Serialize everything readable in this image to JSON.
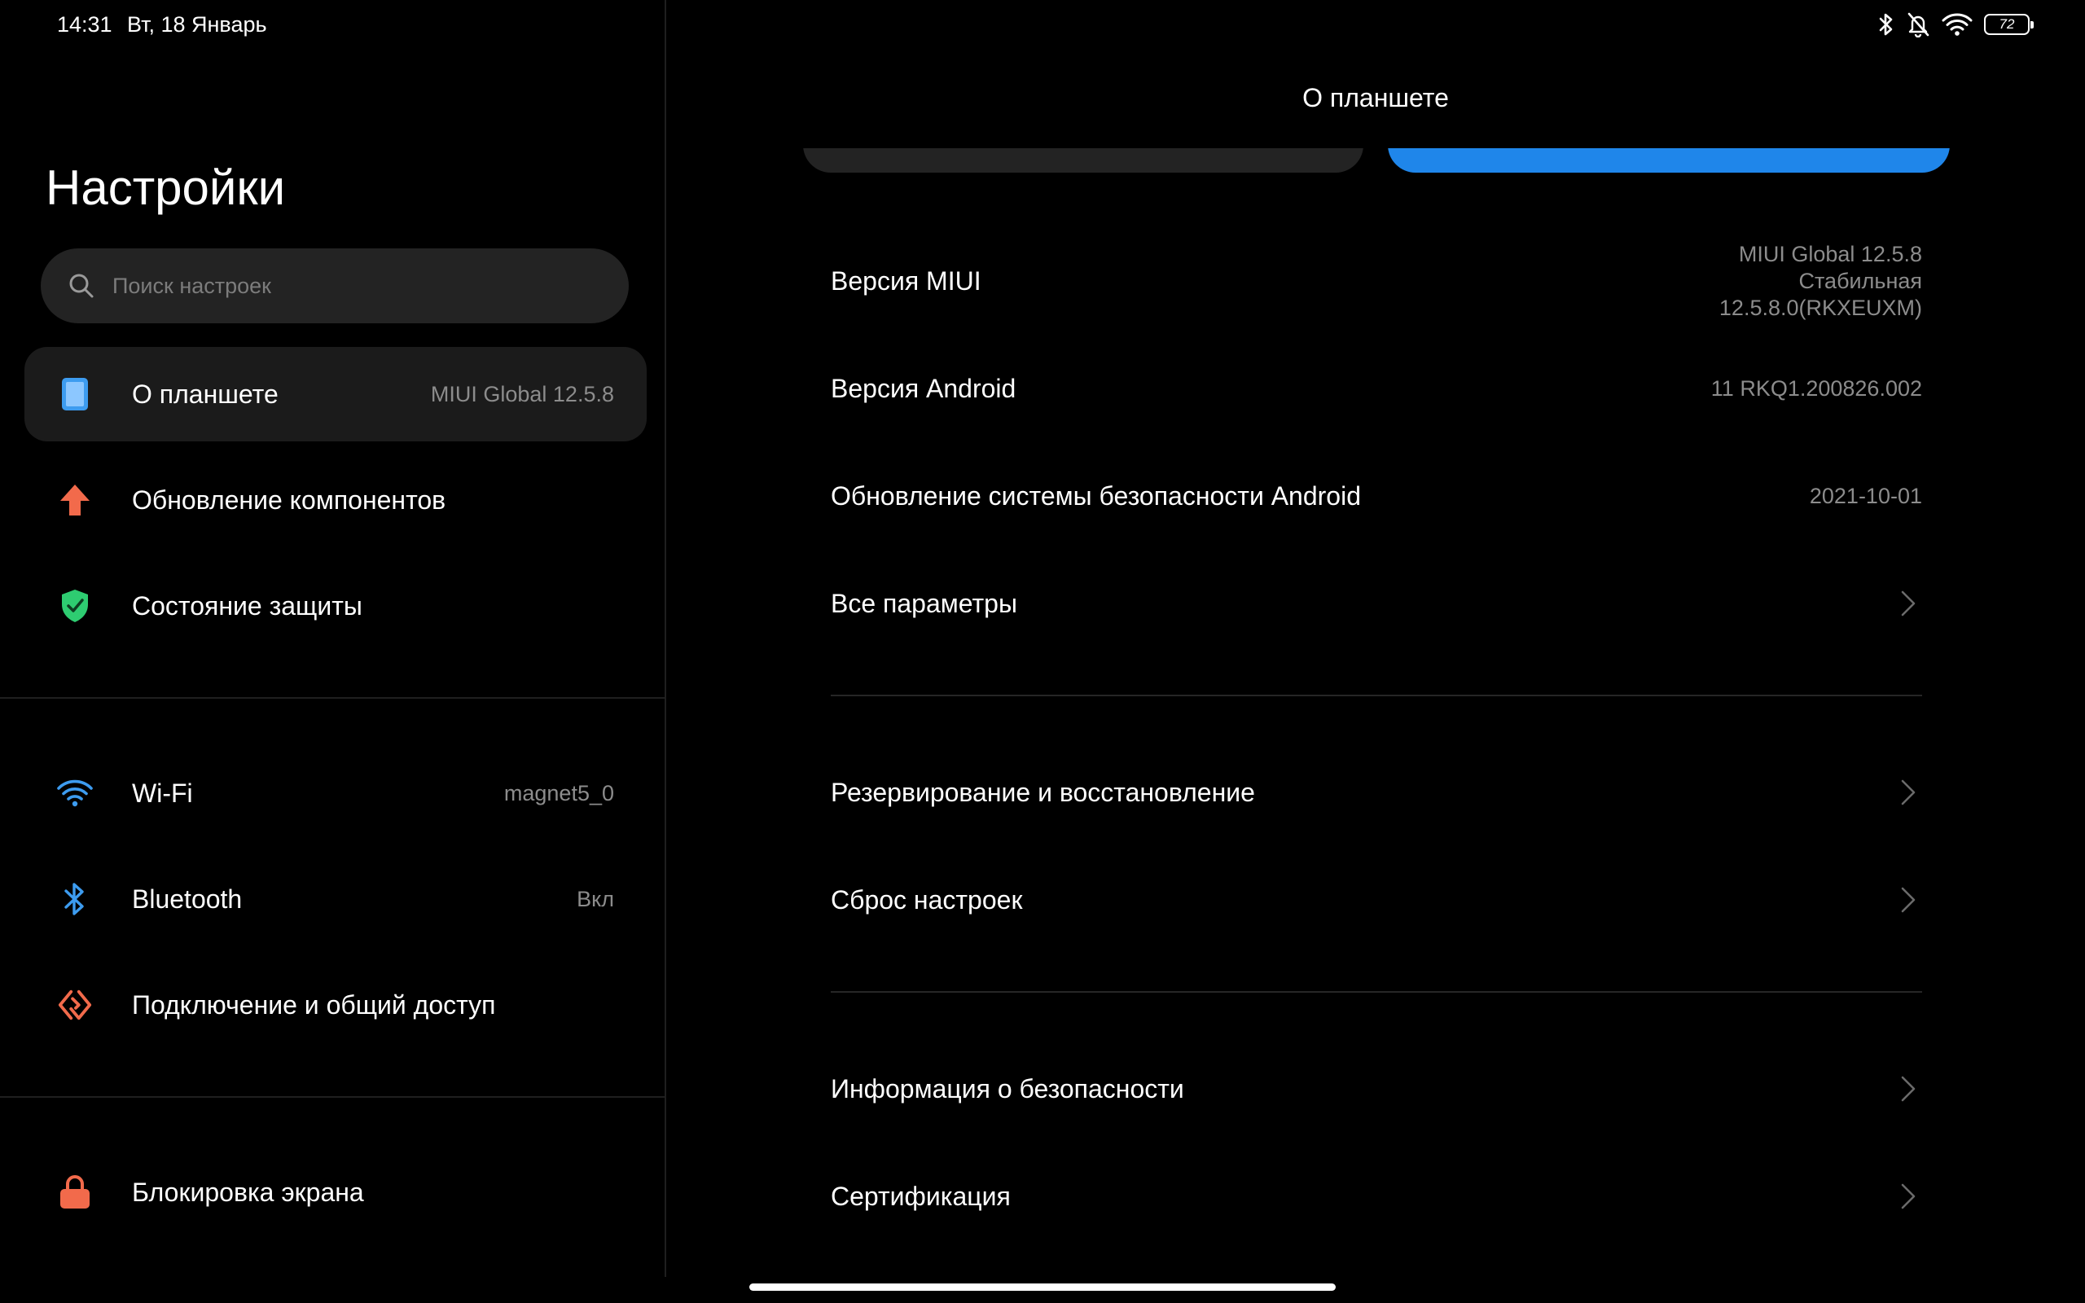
{
  "status_bar": {
    "time": "14:31",
    "date": "Вт, 18 Январь",
    "battery": "72",
    "icons": [
      "bluetooth-icon",
      "bell-off-icon",
      "wifi-icon",
      "battery-icon"
    ]
  },
  "sidebar": {
    "title": "Настройки",
    "search_placeholder": "Поиск настроек",
    "items": [
      {
        "label": "О планшете",
        "value": "MIUI Global 12.5.8",
        "icon": "tablet-icon",
        "color": "#3d9cf0",
        "active": true
      },
      {
        "label": "Обновление компонентов",
        "value": "",
        "icon": "arrow-up-icon",
        "color": "#f26a4b"
      },
      {
        "label": "Состояние защиты",
        "value": "",
        "icon": "shield-check-icon",
        "color": "#2ecc71"
      },
      {
        "label": "Wi-Fi",
        "value": "magnet5_0",
        "icon": "wifi-icon",
        "color": "#3d9cf0"
      },
      {
        "label": "Bluetooth",
        "value": "Вкл",
        "icon": "bluetooth-icon",
        "color": "#3d9cf0"
      },
      {
        "label": "Подключение и общий доступ",
        "value": "",
        "icon": "connection-share-icon",
        "color": "#f26a4b"
      },
      {
        "label": "Блокировка экрана",
        "value": "",
        "icon": "lock-icon",
        "color": "#f26a4b"
      }
    ]
  },
  "main": {
    "title": "О планшете",
    "rows": [
      {
        "label": "Версия MIUI",
        "value_lines": [
          "MIUI Global 12.5.8",
          "Стабильная",
          "12.5.8.0(RKXEUXM)"
        ]
      },
      {
        "label": "Версия Android",
        "value": "11 RKQ1.200826.002"
      },
      {
        "label": "Обновление системы безопасности Android",
        "value": "2021-10-01"
      },
      {
        "label": "Все параметры",
        "chevron": true
      },
      {
        "label": "Резервирование и восстановление",
        "chevron": true
      },
      {
        "label": "Сброс настроек",
        "chevron": true
      },
      {
        "label": "Информация о безопасности",
        "chevron": true
      },
      {
        "label": "Сертификация",
        "chevron": true
      }
    ],
    "accent_color": "#1f86ea"
  }
}
